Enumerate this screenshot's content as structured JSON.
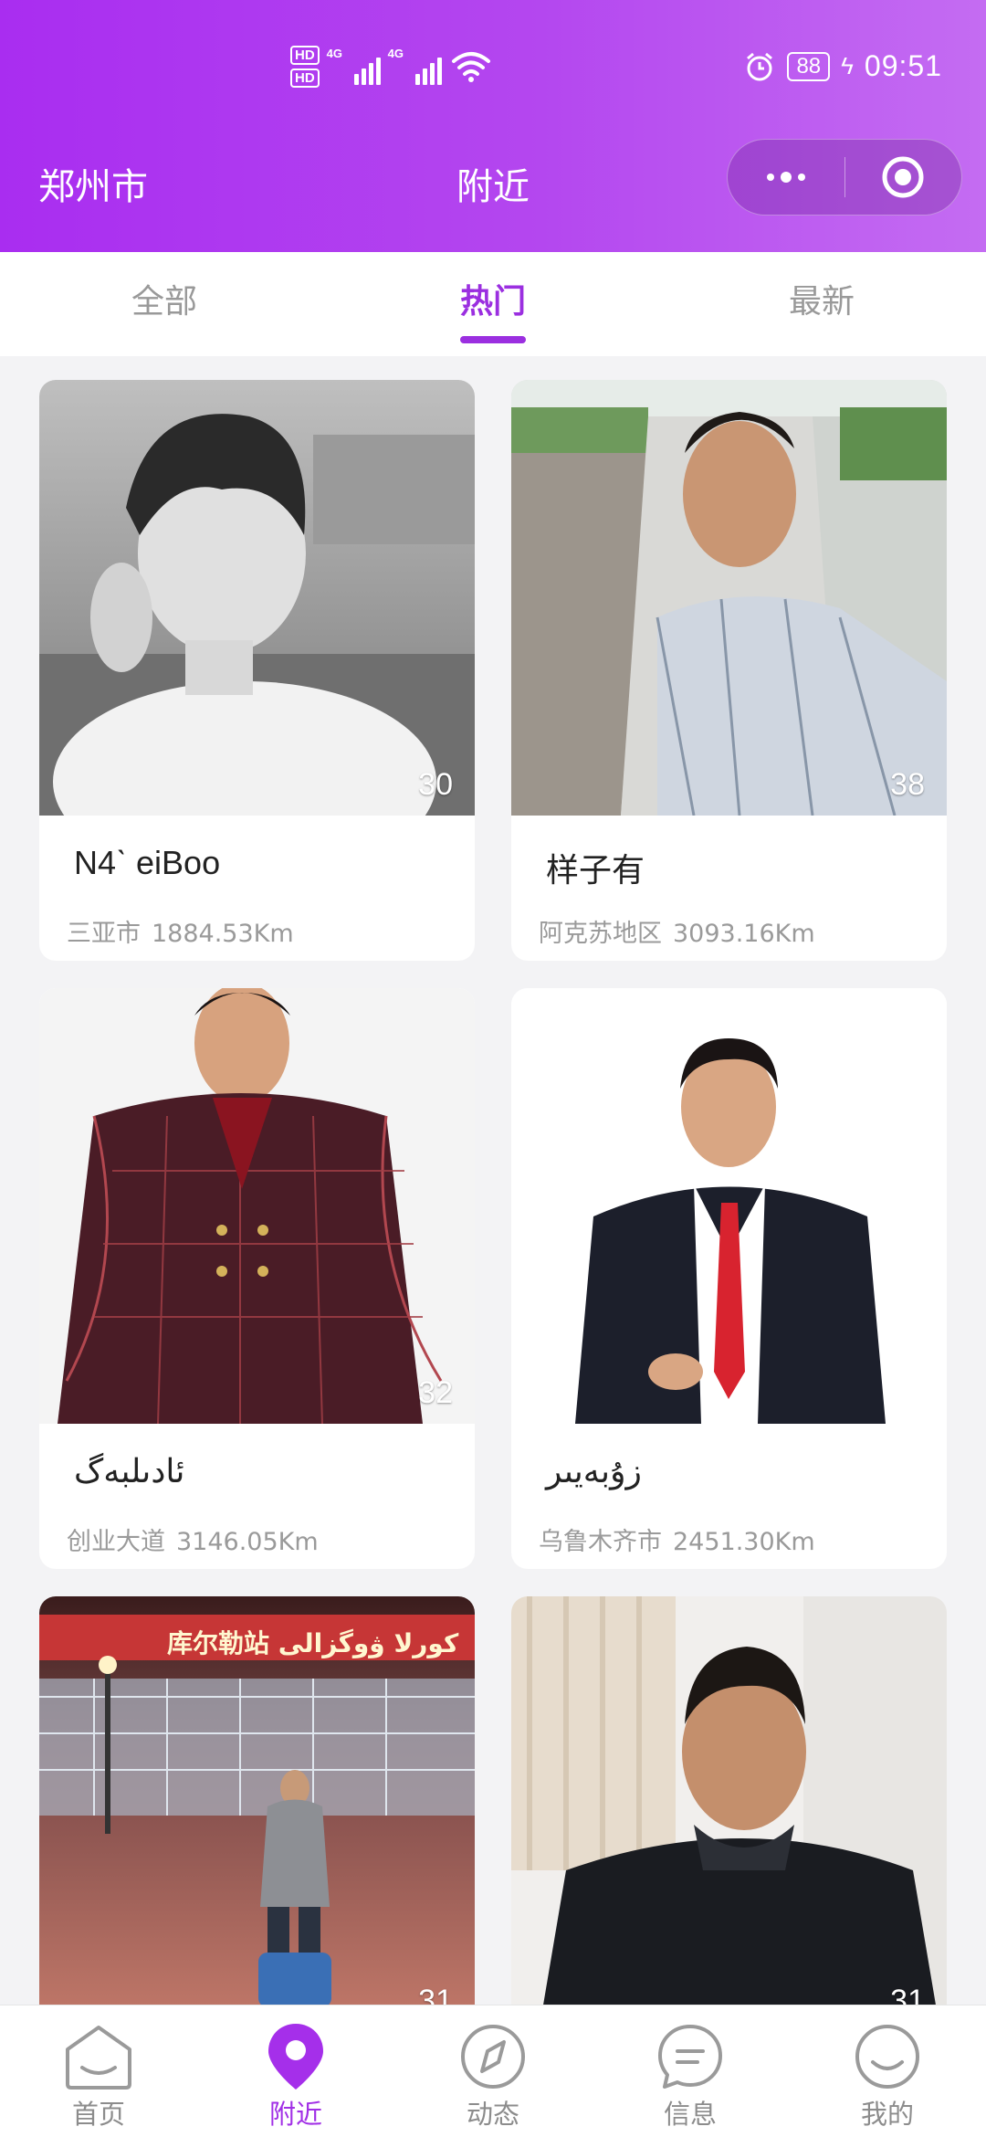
{
  "status_bar": {
    "hd1": "HD",
    "hd2": "HD",
    "net1": "4G",
    "net2": "4G",
    "battery": "88",
    "time": "09:51",
    "icons": [
      "signal-icon",
      "wifi-icon",
      "alarm-icon",
      "charging-icon"
    ]
  },
  "header": {
    "city": "郑州市",
    "title": "附近",
    "more_icon": "more-dots-icon",
    "close_icon": "target-circle-icon"
  },
  "tabs": [
    {
      "label": "全部",
      "active": false
    },
    {
      "label": "热门",
      "active": true
    },
    {
      "label": "最新",
      "active": false
    }
  ],
  "cards": [
    {
      "name": "N4ˋ  eiBoo",
      "location": "三亚市",
      "distance": "1884.53Km",
      "age": "30"
    },
    {
      "name": "样子有",
      "location": "阿克苏地区",
      "distance": "3093.16Km",
      "age": "38"
    },
    {
      "name": "ئادىلبەگ",
      "location": "创业大道",
      "distance": "3146.05Km",
      "age": "32"
    },
    {
      "name": "زۇبەيىر",
      "location": "乌鲁木齐市",
      "distance": "2451.30Km",
      "age": ""
    },
    {
      "name": "",
      "location": "",
      "distance": "",
      "age": "31",
      "sign": "库尔勒站 كورلا ۋوگزالى"
    },
    {
      "name": "",
      "location": "",
      "distance": "",
      "age": "31"
    }
  ],
  "bottom_nav": [
    {
      "label": "首页",
      "icon": "home-icon",
      "active": false
    },
    {
      "label": "附近",
      "icon": "location-pin-icon",
      "active": true
    },
    {
      "label": "动态",
      "icon": "compass-icon",
      "active": false
    },
    {
      "label": "信息",
      "icon": "message-icon",
      "active": false
    },
    {
      "label": "我的",
      "icon": "smile-icon",
      "active": false
    }
  ],
  "colors": {
    "accent": "#9b2fe0",
    "header_start": "#a92df0",
    "header_end": "#c46cf2"
  }
}
